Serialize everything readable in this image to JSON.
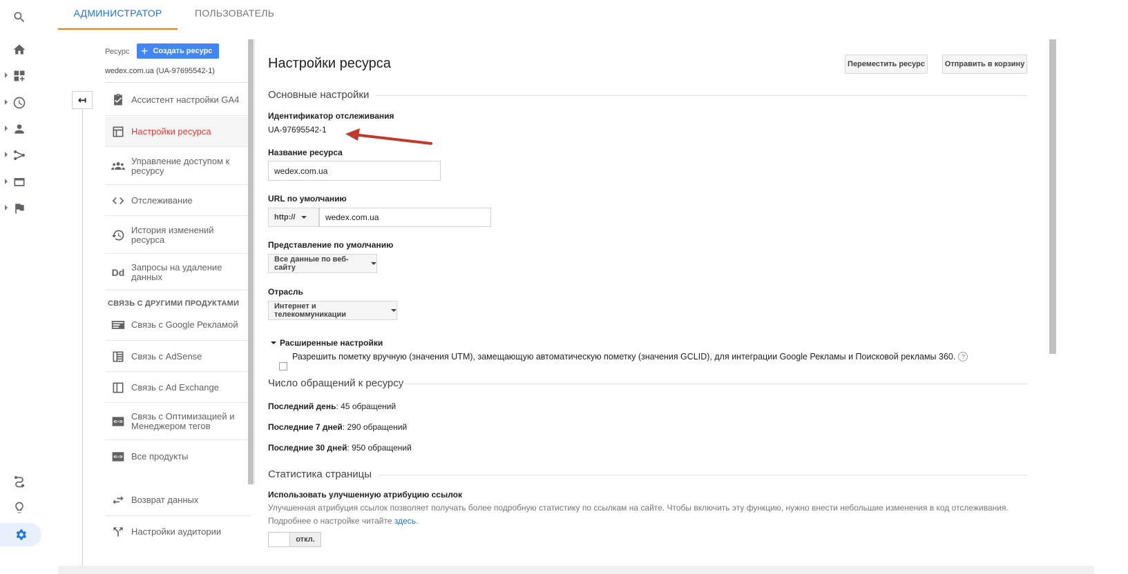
{
  "tabs": {
    "admin": "АДМИНИСТРАТОР",
    "user": "ПОЛЬЗОВАТЕЛЬ"
  },
  "resource": {
    "label": "Ресурс",
    "create_button": "Создать ресурс",
    "name": "wedex.com.ua (UA-97695542-1)"
  },
  "nav": {
    "items": [
      {
        "label": "Ассистент настройки GA4",
        "icon": "checklist-icon"
      },
      {
        "label": "Настройки ресурса",
        "icon": "layout-icon"
      },
      {
        "label": "Управление доступом к ресурсу",
        "icon": "people-icon"
      },
      {
        "label": "Отслеживание",
        "icon": "code-icon"
      },
      {
        "label": "История изменений ресурса",
        "icon": "history-icon"
      },
      {
        "label": "Запросы на удаление данных",
        "icon": "dd-icon"
      }
    ],
    "section": "СВЯЗЬ С ДРУГИМИ ПРОДУКТАМИ",
    "links": [
      {
        "label": "Связь с Google Рекламой",
        "icon": "ads-icon"
      },
      {
        "label": "Связь с AdSense",
        "icon": "adsense-icon"
      },
      {
        "label": "Связь с Ad Exchange",
        "icon": "adexchange-icon"
      },
      {
        "label": "Связь с Оптимизацией и Менеджером тегов",
        "icon": "link-icon"
      },
      {
        "label": "Все продукты",
        "icon": "link-icon"
      }
    ],
    "extra": [
      {
        "label": "Возврат данных",
        "icon": "swap-icon"
      },
      {
        "label": "Настройки аудитории",
        "icon": "fork-icon"
      }
    ]
  },
  "main": {
    "title": "Настройки ресурса",
    "move_button": "Переместить ресурс",
    "trash_button": "Отправить в корзину",
    "basic_heading": "Основные настройки",
    "tracking_id_label": "Идентификатор отслеживания",
    "tracking_id": "UA-97695542-1",
    "resource_name_label": "Название ресурса",
    "resource_name": "wedex.com.ua",
    "default_url_label": "URL по умолчанию",
    "protocol": "http://",
    "default_url": "wedex.com.ua",
    "default_view_label": "Представление по умолчанию",
    "default_view": "Все данные по веб-сайту",
    "industry_label": "Отрасль",
    "industry": "Интернет и телекоммуникации",
    "advanced_label": "Расширенные настройки",
    "advanced_checkbox": "Разрешить пометку вручную (значения UTM), замещающую автоматическую пометку (значения GCLID), для интеграции Google Рекламы и Поисковой рекламы 360.",
    "hits_heading": "Число обращений к ресурсу",
    "hits": [
      {
        "label": "Последний день",
        "value": "45 обращений"
      },
      {
        "label": "Последние 7 дней",
        "value": "290 обращений"
      },
      {
        "label": "Последние 30 дней",
        "value": "950 обращений"
      }
    ],
    "page_stats_heading": "Статистика страницы",
    "attribution_label": "Использовать улучшенную атрибуцию ссылок",
    "attribution_desc": "Улучшенная атрибуция ссылок позволяет получать более подробную статистику по ссылкам на сайте. Чтобы включить эту функцию, нужно внести небольшие изменения в код отслеживания. Подробнее о настройке читайте ",
    "attribution_link": "здесь",
    "attribution_tail": ".",
    "toggle_state": "откл."
  },
  "colors": {
    "accent": "#1a73e8",
    "active_nav": "#e53935",
    "tab_underline": "#f57c00",
    "arrow": "#c0392b"
  }
}
